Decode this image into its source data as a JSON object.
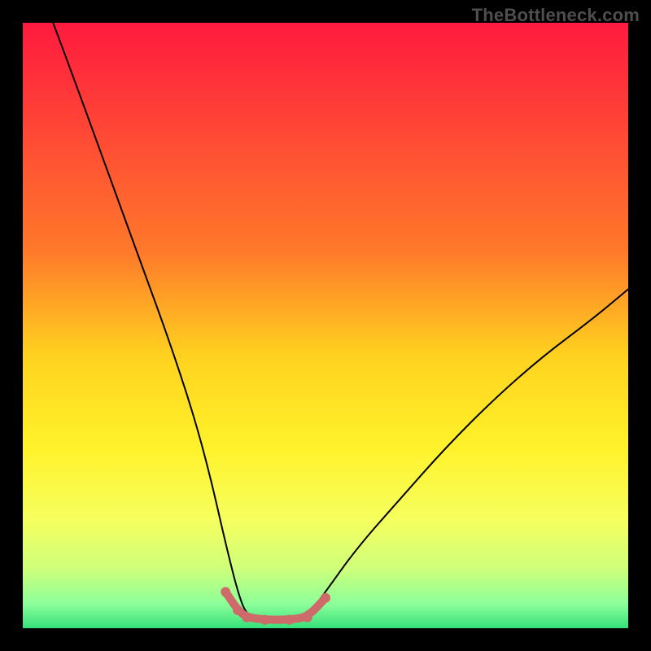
{
  "watermark": {
    "text": "TheBottleneck.com"
  },
  "chart_data": {
    "type": "line",
    "title": "",
    "xlabel": "",
    "ylabel": "",
    "xlim": [
      0,
      100
    ],
    "ylim": [
      0,
      100
    ],
    "grid": false,
    "legend": false,
    "background_gradient_stops": [
      {
        "pct": 0,
        "color": "#ff1a3f"
      },
      {
        "pct": 38,
        "color": "#ff7a2a"
      },
      {
        "pct": 55,
        "color": "#ffd21f"
      },
      {
        "pct": 70,
        "color": "#fff22a"
      },
      {
        "pct": 82,
        "color": "#f6ff5e"
      },
      {
        "pct": 90,
        "color": "#d0ff7a"
      },
      {
        "pct": 96,
        "color": "#8cff9a"
      },
      {
        "pct": 100,
        "color": "#35e07a"
      }
    ],
    "series": [
      {
        "name": "main-curve",
        "color": "#000000",
        "width": 2,
        "x": [
          5,
          8,
          12,
          16,
          20,
          24,
          28,
          31,
          33.5,
          35.5,
          37,
          40,
          44,
          47,
          50,
          55,
          62,
          70,
          78,
          86,
          94,
          100
        ],
        "values": [
          100,
          92,
          81,
          70,
          59,
          48,
          36,
          25,
          14,
          6,
          2,
          1,
          1,
          2,
          6,
          13,
          21,
          30,
          38,
          45,
          51,
          56
        ]
      },
      {
        "name": "valley-marker",
        "color": "#cf6a6a",
        "width": 10,
        "marker_radius": 6,
        "x": [
          33.5,
          35.5,
          37,
          40,
          44,
          47,
          50
        ],
        "values": [
          6,
          3,
          1.8,
          1.4,
          1.4,
          1.8,
          5
        ]
      }
    ]
  }
}
